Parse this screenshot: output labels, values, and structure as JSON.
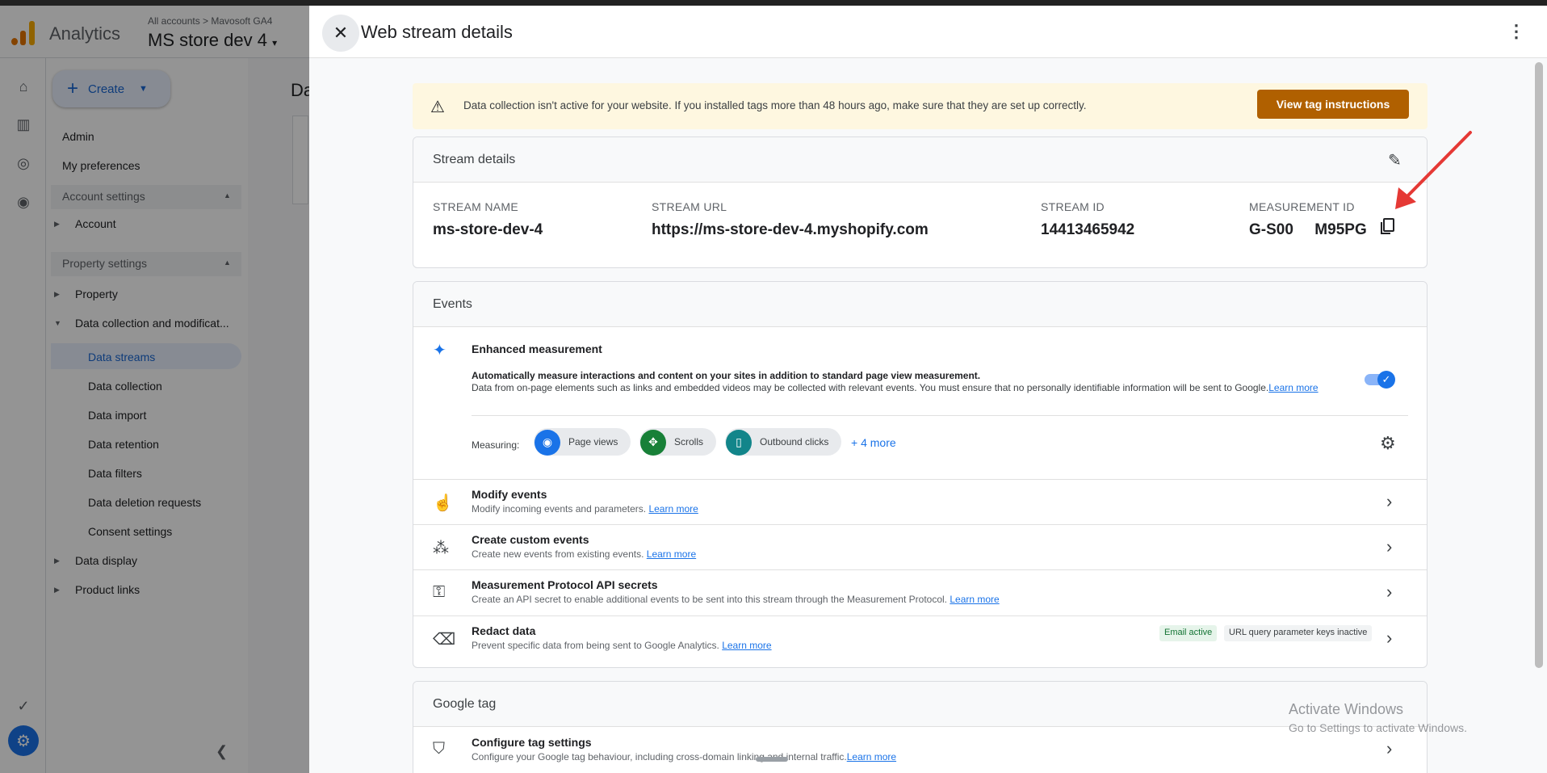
{
  "ga": {
    "app_name": "Analytics",
    "breadcrumb": "All accounts > Mavosoft GA4",
    "property": "MS store dev 4",
    "main_label": "Da",
    "create_label": "Create",
    "nav": {
      "admin": "Admin",
      "preferences": "My preferences",
      "account_settings": "Account settings",
      "account": "Account",
      "property_settings": "Property settings",
      "property": "Property",
      "data_collection_mod": "Data collection and modificat...",
      "data_streams": "Data streams",
      "data_collection": "Data collection",
      "data_import": "Data import",
      "data_retention": "Data retention",
      "data_filters": "Data filters",
      "data_deletion": "Data deletion requests",
      "consent": "Consent settings",
      "data_display": "Data display",
      "product_links": "Product links"
    }
  },
  "dialog": {
    "title": "Web stream details",
    "alert": {
      "text": "Data collection isn't active for your website. If you installed tags more than 48 hours ago, make sure that they are set up correctly.",
      "button": "View tag instructions"
    },
    "stream_details": {
      "title": "Stream details",
      "name_label": "STREAM NAME",
      "name_value": "ms-store-dev-4",
      "url_label": "STREAM URL",
      "url_value": "https://ms-store-dev-4.myshopify.com",
      "id_label": "STREAM ID",
      "id_value": "14413465942",
      "mid_label": "MEASUREMENT ID",
      "mid_value": "G-S00     M95PG"
    },
    "events": {
      "title": "Events",
      "enhanced": {
        "title": "Enhanced measurement",
        "desc1": "Automatically measure interactions and content on your sites in addition to standard page view measurement.",
        "desc2": "Data from on-page elements such as links and embedded videos may be collected with relevant events. You must ensure that no personally identifiable information will be sent to Google.",
        "learn_more": "Learn more",
        "measuring_label": "Measuring:",
        "chips": [
          "Page views",
          "Scrolls",
          "Outbound clicks"
        ],
        "more": "+ 4 more",
        "enabled": true
      },
      "rows": [
        {
          "title": "Modify events",
          "sub": "Modify incoming events and parameters.",
          "link": "Learn more"
        },
        {
          "title": "Create custom events",
          "sub": "Create new events from existing events.",
          "link": "Learn more"
        },
        {
          "title": "Measurement Protocol API secrets",
          "sub": "Create an API secret to enable additional events to be sent into this stream through the Measurement Protocol.",
          "link": "Learn more"
        },
        {
          "title": "Redact data",
          "sub": "Prevent specific data from being sent to Google Analytics.",
          "link": "Learn more",
          "status_a": "Email active",
          "status_b": "URL query parameter keys inactive"
        }
      ]
    },
    "google_tag": {
      "title": "Google tag",
      "configure_title": "Configure tag settings",
      "configure_sub": "Configure your Google tag behaviour, including cross-domain linking and internal traffic.",
      "link": "Learn more"
    }
  },
  "watermark": {
    "line1": "Activate Windows",
    "line2": "Go to Settings to activate Windows."
  },
  "colors": {
    "accent": "#1a73e8",
    "alert_bg": "#fef7e0",
    "alert_button": "#b06000",
    "arrow": "#e53935"
  }
}
